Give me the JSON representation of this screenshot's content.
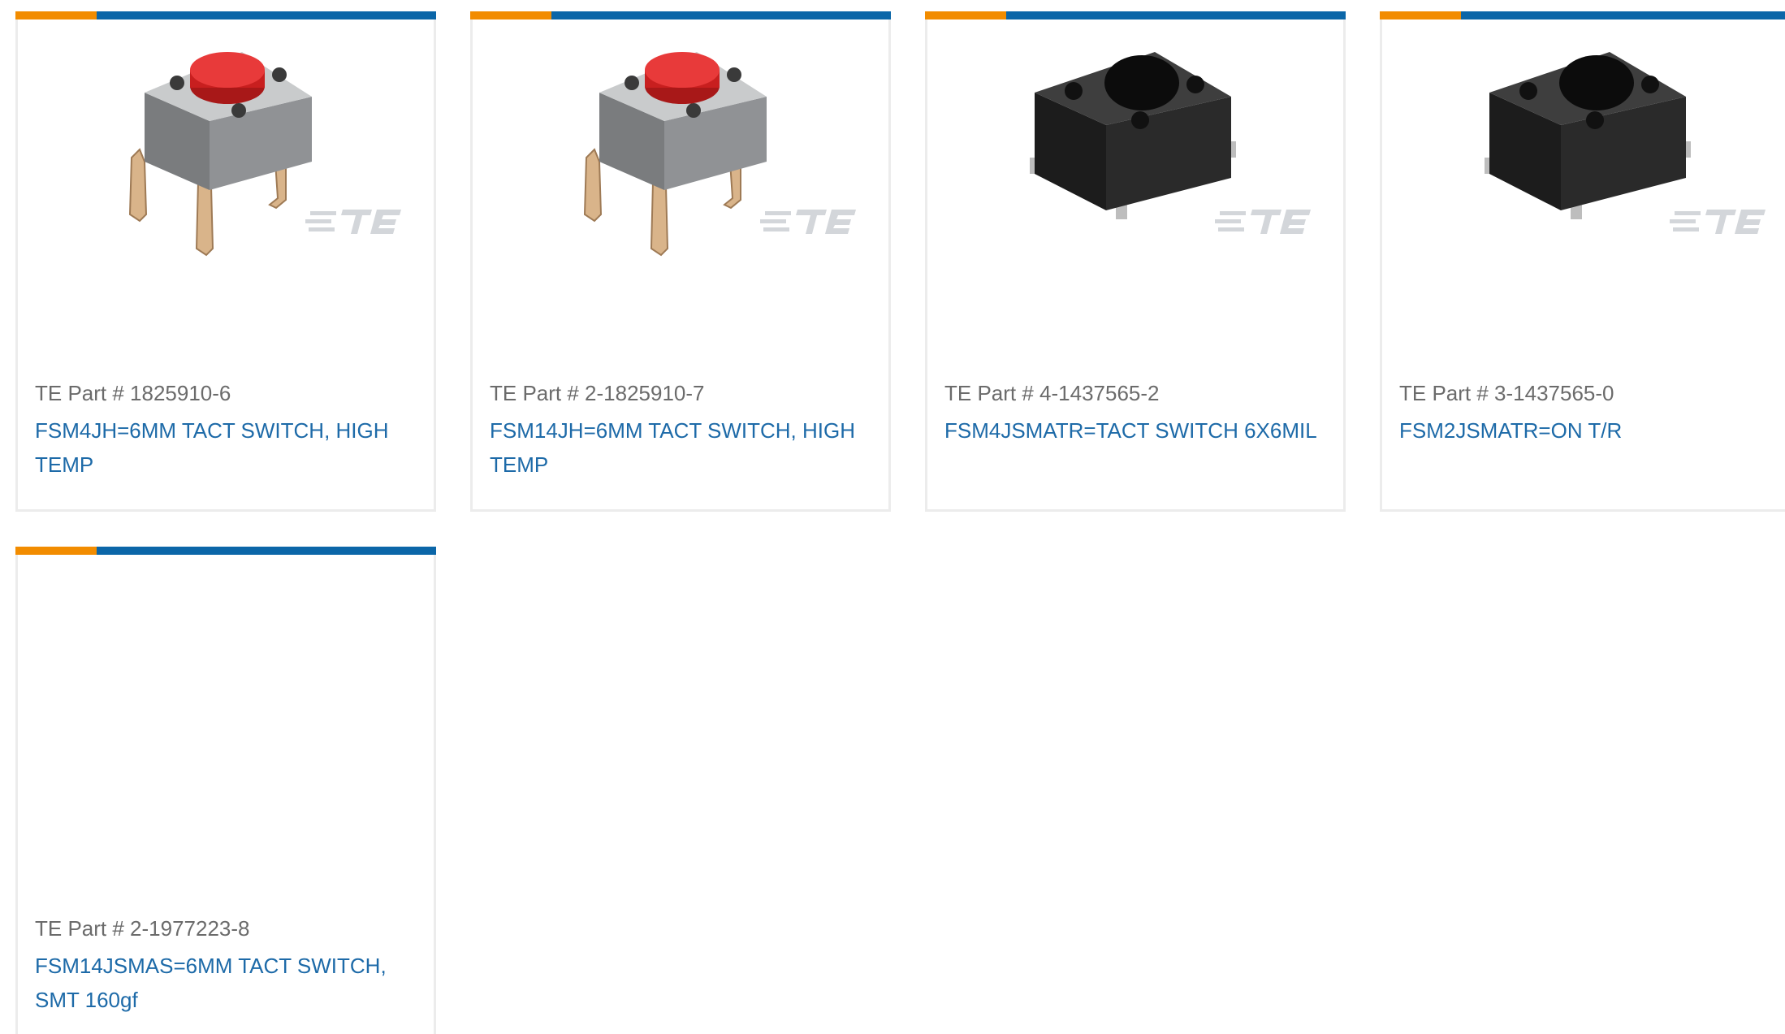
{
  "products": [
    {
      "part_label": "TE Part # 1825910-6",
      "description": "FSM4JH=6MM TACT SWITCH, HIGH TEMP",
      "image": "red-tact-switch-through-hole",
      "brand_watermark": "TE"
    },
    {
      "part_label": "TE Part # 2-1825910-7",
      "description": "FSM14JH=6MM TACT SWITCH, HIGH TEMP",
      "image": "red-tact-switch-through-hole",
      "brand_watermark": "TE"
    },
    {
      "part_label": "TE Part # 4-1437565-2",
      "description": "FSM4JSMATR=TACT SWITCH 6X6MIL",
      "image": "black-tact-switch-smt",
      "brand_watermark": "TE"
    },
    {
      "part_label": "TE Part # 3-1437565-0",
      "description": "FSM2JSMATR=ON T/R",
      "image": "black-tact-switch-smt",
      "brand_watermark": "TE"
    },
    {
      "part_label": "TE Part # 2-1977223-8",
      "description": "FSM14JSMAS=6MM TACT SWITCH, SMT 160gf",
      "image": "none"
    }
  ],
  "colors": {
    "accent_orange": "#f28c00",
    "accent_blue": "#0b66a8",
    "link_blue": "#1d6aa8",
    "part_grey": "#6b6b6b",
    "card_border": "#ececec"
  }
}
